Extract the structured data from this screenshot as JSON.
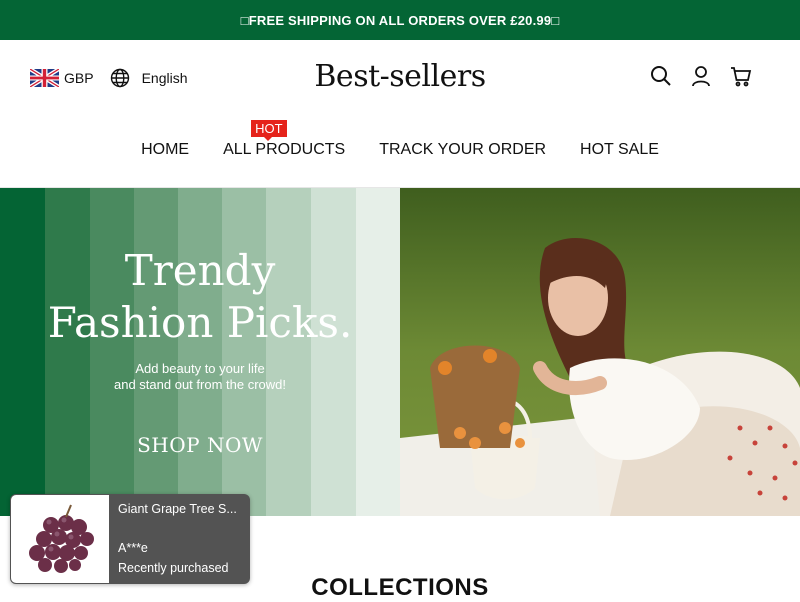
{
  "announcement": {
    "text": "□FREE SHIPPING ON ALL ORDERS OVER £20.99□"
  },
  "header": {
    "currency": "GBP",
    "language": "English",
    "logo": "Best-sellers",
    "icons": [
      "search-icon",
      "account-icon",
      "cart-icon"
    ]
  },
  "nav": {
    "items": [
      "HOME",
      "ALL PRODUCTS",
      "TRACK YOUR ORDER",
      "HOT SALE"
    ],
    "badge": "HOT"
  },
  "hero": {
    "title_line1": "Trendy",
    "title_line2": "Fashion Picks.",
    "subtitle_line1": "Add beauty to your life",
    "subtitle_line2": "and stand out from the crowd!",
    "cta": "SHOP NOW"
  },
  "purchase_popup": {
    "product": "Giant Grape Tree S...",
    "buyer": "A***e",
    "status": "Recently purchased"
  },
  "section": {
    "title": "COLLECTIONS"
  },
  "colors": {
    "brand_green": "#046535",
    "hot_red": "#e5231b",
    "popup_bg": "#535353"
  }
}
